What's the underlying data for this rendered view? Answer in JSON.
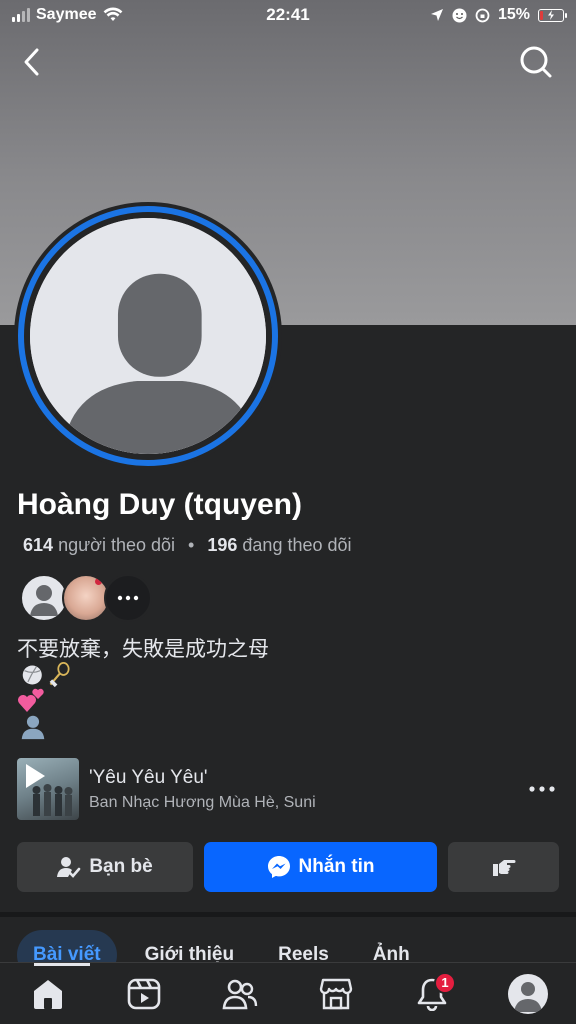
{
  "status_bar": {
    "carrier": "Saymee",
    "time": "22:41",
    "battery_percent": "15%",
    "battery_level": 0.15,
    "icons": [
      "signal-icon",
      "wifi-icon",
      "location-icon",
      "face-icon",
      "rotation-lock-icon",
      "battery-icon"
    ]
  },
  "header": {
    "back_icon": "chevron-left-icon",
    "search_icon": "search-icon"
  },
  "profile": {
    "name": "Hoàng Duy (tquyen)",
    "followers_count": "614",
    "followers_label": "người theo dõi",
    "separator": "•",
    "following_count": "196",
    "following_label": "đang theo dõi",
    "bio_line": "不要放棄，失敗是成功之母"
  },
  "music": {
    "title": "'Yêu Yêu Yêu'",
    "artist": "Ban Nhạc Hương Mùa Hè, Suni"
  },
  "actions": {
    "friends_label": "Bạn bè",
    "message_label": "Nhắn tin"
  },
  "tabs": [
    {
      "label": "Bài viết",
      "active": true
    },
    {
      "label": "Giới thiệu",
      "active": false
    },
    {
      "label": "Reels",
      "active": false
    },
    {
      "label": "Ảnh",
      "active": false
    }
  ],
  "bottom_nav": {
    "notification_badge": "1",
    "items": [
      "home-icon",
      "video-icon",
      "friends-icon",
      "marketplace-icon",
      "notifications-icon",
      "profile-icon"
    ]
  },
  "colors": {
    "accent": "#0866ff",
    "ring": "#1b74e4",
    "background": "#242526",
    "badge": "#e41e3f"
  }
}
